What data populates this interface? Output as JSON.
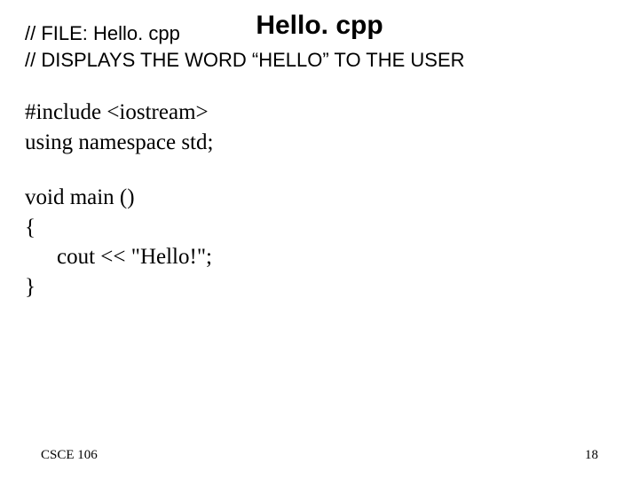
{
  "title": "Hello. cpp",
  "comments": {
    "line1": "// FILE: Hello. cpp",
    "line2": "// DISPLAYS THE WORD “HELLO” TO THE USER"
  },
  "code": {
    "include": "#include <iostream>",
    "using": "using namespace std;",
    "main_sig": "void main ()",
    "brace_open": "{",
    "cout_line": "cout << \"Hello!\";",
    "brace_close": "}"
  },
  "footer": {
    "left": "CSCE 106",
    "page": "18"
  }
}
